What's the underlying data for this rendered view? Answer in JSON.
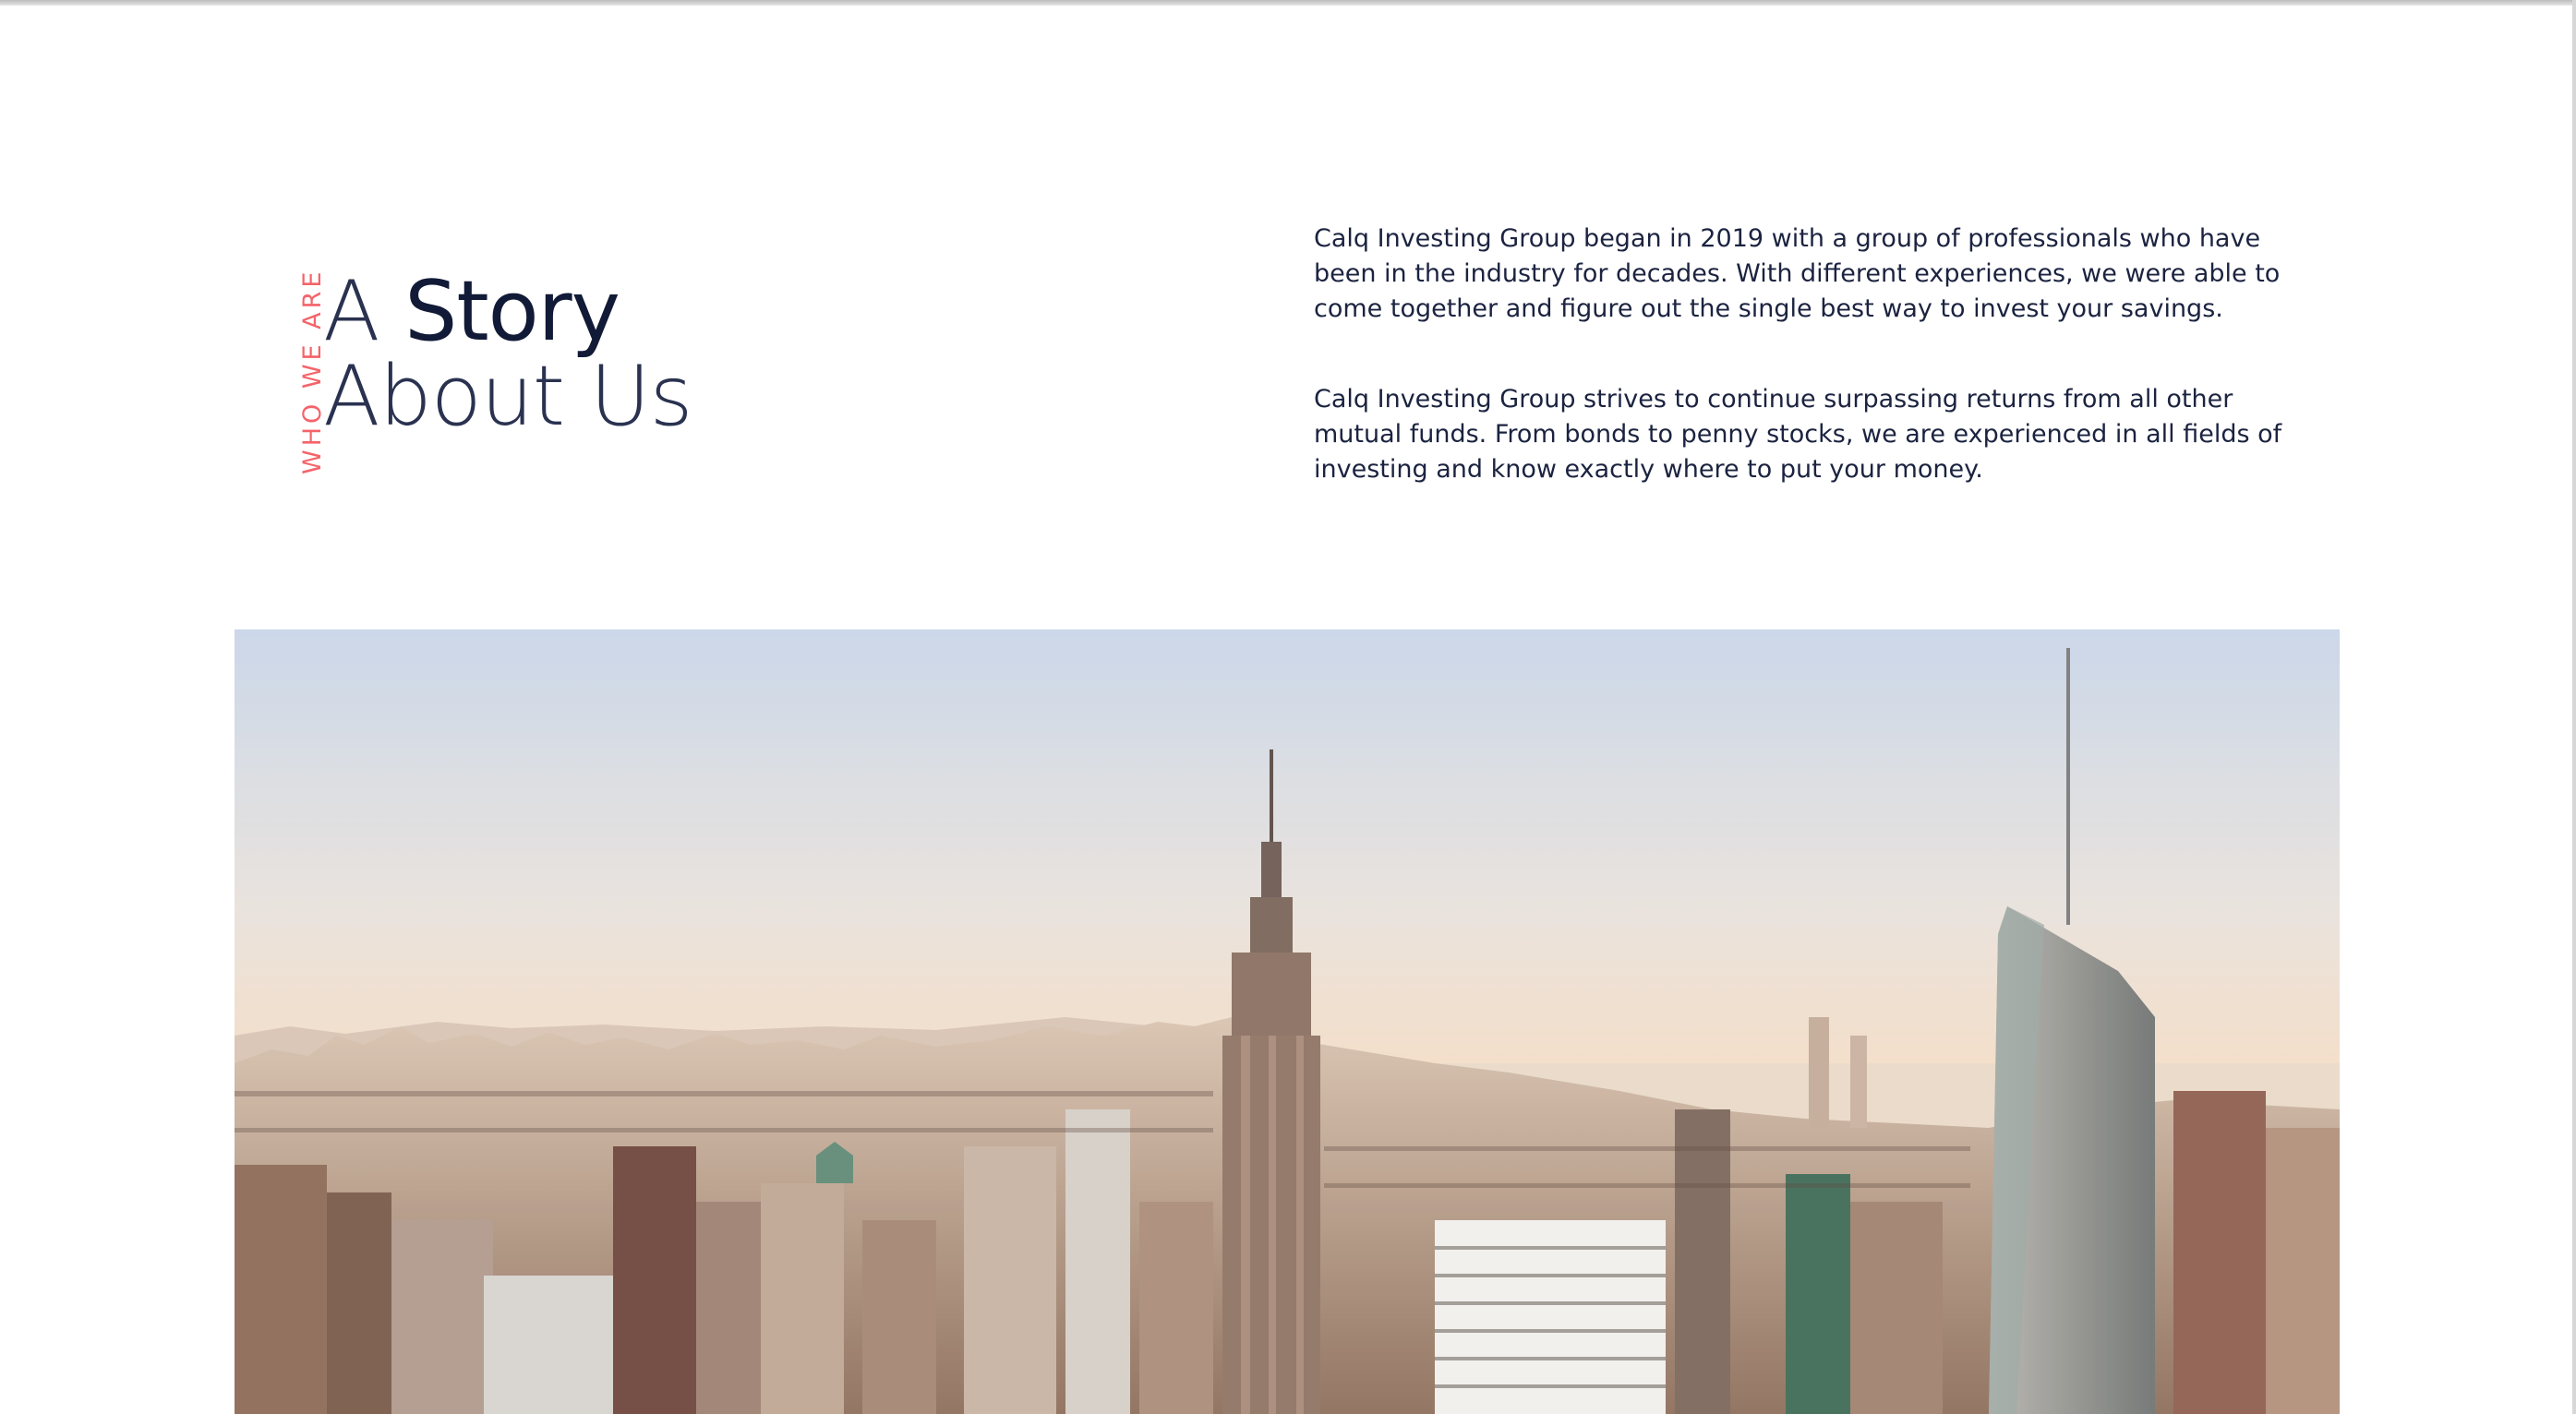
{
  "about": {
    "eyebrow": "WHO WE ARE",
    "heading_line1_light": "A ",
    "heading_line1_bold": "Story",
    "heading_line2": "About Us",
    "paragraphs": [
      "Calq Investing Group began in 2019 with a group of professionals who have been in the industry for decades. With different experiences, we were able to come together and figure out the single best way to invest your savings.",
      "Calq Investing Group strives to continue surpassing returns from all other mutual funds. From bonds to penny stocks, we are experienced in all fields of investing and know exactly where to put your money."
    ]
  },
  "colors": {
    "accent": "#f4646a",
    "text": "#1b2340",
    "sky_top": "#c9d5e8",
    "sky_bottom": "#f7dcc0"
  },
  "hero": {
    "icon": "city-skyline-image"
  }
}
